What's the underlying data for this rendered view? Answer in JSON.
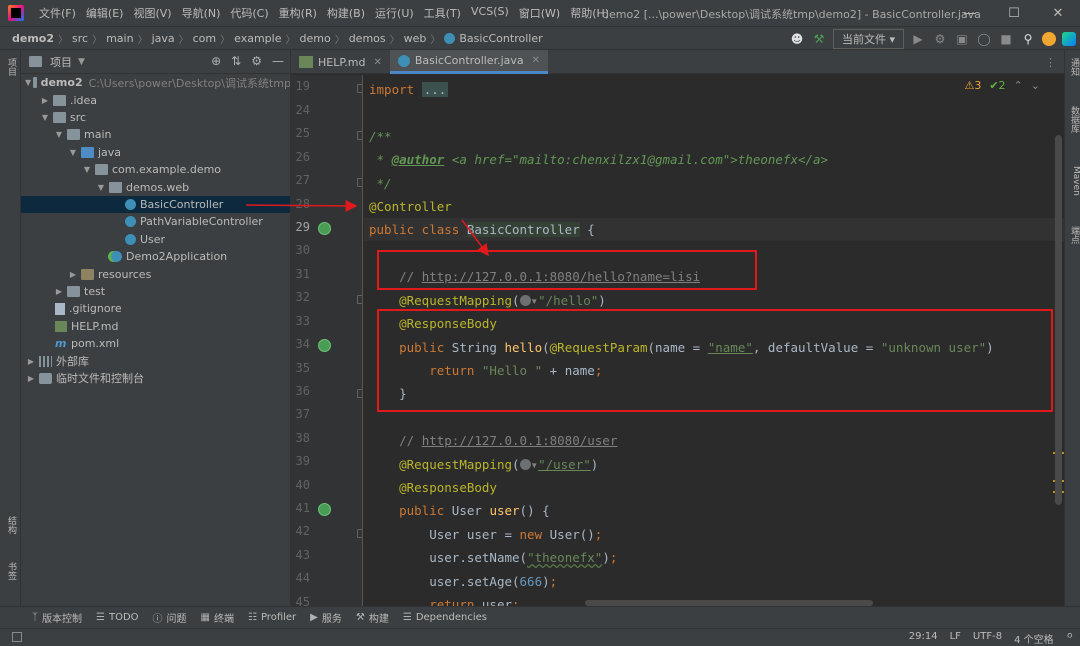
{
  "titlebar": {
    "menu": [
      "文件(F)",
      "编辑(E)",
      "视图(V)",
      "导航(N)",
      "代码(C)",
      "重构(R)",
      "构建(B)",
      "运行(U)",
      "工具(T)",
      "VCS(S)",
      "窗口(W)",
      "帮助(H)"
    ],
    "window_title": "demo2 [...\\power\\Desktop\\调试系统tmp\\demo2] - BasicController.java",
    "controls": [
      "—",
      "☐",
      "✕"
    ]
  },
  "navbar": {
    "crumbs": [
      "demo2",
      "src",
      "main",
      "java",
      "com",
      "example",
      "demo",
      "demos",
      "web",
      "BasicController"
    ],
    "run_config": "当前文件 ▾"
  },
  "left_stripe": {
    "top": "项目",
    "bottom1": "结构",
    "bottom2": "书签"
  },
  "right_stripe": [
    "通知",
    "数据库",
    "Maven",
    "端点"
  ],
  "project": {
    "title": "项目",
    "root_name": "demo2",
    "root_path": "C:\\Users\\power\\Desktop\\调试系统tmp",
    "items": [
      {
        "label": "demo2"
      },
      {
        "label": ".idea"
      },
      {
        "label": "src"
      },
      {
        "label": "main"
      },
      {
        "label": "java"
      },
      {
        "label": "com.example.demo"
      },
      {
        "label": "demos.web"
      },
      {
        "label": "BasicController"
      },
      {
        "label": "PathVariableController"
      },
      {
        "label": "User"
      },
      {
        "label": "Demo2Application"
      },
      {
        "label": "resources"
      },
      {
        "label": "test"
      },
      {
        "label": ".gitignore"
      },
      {
        "label": "HELP.md"
      },
      {
        "label": "pom.xml"
      },
      {
        "label": "外部库"
      },
      {
        "label": "临时文件和控制台"
      }
    ]
  },
  "tabs": [
    {
      "label": "HELP.md",
      "close": "✕"
    },
    {
      "label": "BasicController.java",
      "close": "✕"
    }
  ],
  "inspections": {
    "warnings": "⚠3",
    "ok": "✔2"
  },
  "line_numbers": [
    "19",
    "24",
    "25",
    "26",
    "27",
    "28",
    "29",
    "30",
    "31",
    "32",
    "33",
    "34",
    "35",
    "36",
    "37",
    "38",
    "39",
    "40",
    "41",
    "42",
    "43",
    "44",
    "45"
  ],
  "code": {
    "l19_kw": "import",
    "l19_fold": "...",
    "l25": "/**",
    "l26_star": " * ",
    "l26_tag": "@author",
    "l26_rest": " <a href=\"mailto:chenxilzx1@gmail.com\">theonefx</a>",
    "l27": " */",
    "l28": "@Controller",
    "l29_kw": "public class ",
    "l29_cls": "BasicController",
    "l29_rest": " {",
    "l31_c": "// ",
    "l31_url": "http://127.0.0.1:8080/hello?name=lisi",
    "l32_ann": "@RequestMapping",
    "l32_open": "(",
    "l32_arrow": "▾",
    "l32_str": "\"/hello\"",
    "l32_close": ")",
    "l33": "@ResponseBody",
    "l34_kw": "public ",
    "l34_type": "String ",
    "l34_fn": "hello",
    "l34_a": "(",
    "l34_ann": "@RequestParam",
    "l34_b": "(name = ",
    "l34_s1": "\"name\"",
    "l34_c": ", defaultValue = ",
    "l34_s2": "\"unknown user\"",
    "l34_d": ")",
    "l35_kw": "return ",
    "l35_str": "\"Hello \"",
    "l35_rest": " + name",
    "l35_semi": ";",
    "l36": "}",
    "l38_c": "// ",
    "l38_url": "http://127.0.0.1:8080/user",
    "l39_ann": "@RequestMapping",
    "l39_open": "(",
    "l39_arrow": "▾",
    "l39_str": "\"/user\"",
    "l39_close": ")",
    "l40": "@ResponseBody",
    "l41_kw": "public ",
    "l41_type": "User ",
    "l41_fn": "user",
    "l41_rest": "() {",
    "l42_a": "User user = ",
    "l42_kw": "new ",
    "l42_b": "User()",
    "l42_semi": ";",
    "l43_a": "user.setName(",
    "l43_str": "\"theonefx\"",
    "l43_b": ")",
    "l43_semi": ";",
    "l44_a": "user.setAge(",
    "l44_num": "666",
    "l44_b": ")",
    "l44_semi": ";",
    "l45_kw": "return ",
    "l45_rest": "user",
    "l45_semi": ";"
  },
  "bottom_tools": [
    "版本控制",
    "TODO",
    "问题",
    "终端",
    "Profiler",
    "服务",
    "构建",
    "Dependencies"
  ],
  "status": {
    "position": "29:14",
    "line_sep": "LF",
    "encoding": "UTF-8",
    "indent": "4 个空格"
  },
  "colors": {
    "keyword": "#cc7832",
    "annotation": "#bbb529",
    "string": "#6a8759",
    "comment": "#808080",
    "highlight_box": "#e0191c"
  }
}
